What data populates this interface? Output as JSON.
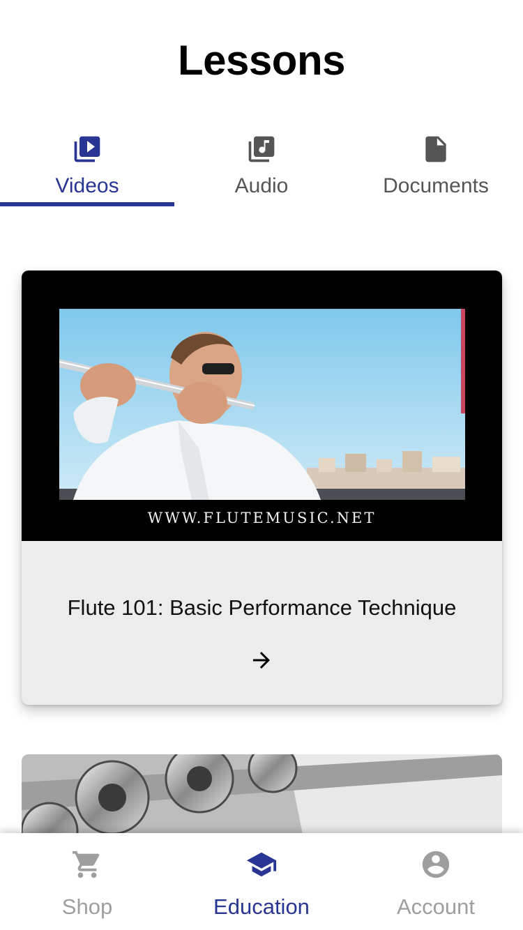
{
  "page": {
    "title": "Lessons"
  },
  "tabs": [
    {
      "label": "Videos",
      "icon": "video-library-icon",
      "active": true
    },
    {
      "label": "Audio",
      "icon": "audio-library-icon",
      "active": false
    },
    {
      "label": "Documents",
      "icon": "document-icon",
      "active": false
    }
  ],
  "lessons": [
    {
      "title": "Flute 101: Basic Performance Technique",
      "thumbnail_watermark": "WWW.FLUTEMUSIC.NET",
      "arrow_icon": "arrow-right-icon"
    }
  ],
  "bottom_nav": [
    {
      "label": "Shop",
      "icon": "cart-icon",
      "active": false
    },
    {
      "label": "Education",
      "icon": "school-icon",
      "active": true
    },
    {
      "label": "Account",
      "icon": "account-circle-icon",
      "active": false
    }
  ],
  "colors": {
    "accent": "#283593",
    "inactive_tab": "#555555",
    "inactive_nav": "#9e9e9e",
    "card_bg": "#ececec"
  }
}
